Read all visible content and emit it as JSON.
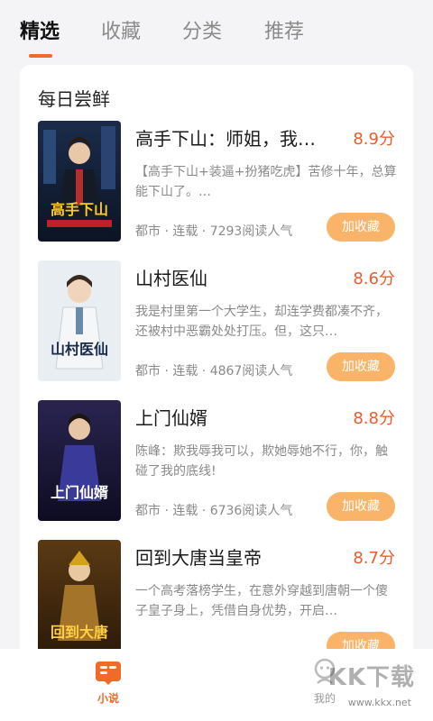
{
  "tabs": [
    {
      "label": "精选",
      "active": true
    },
    {
      "label": "收藏",
      "active": false
    },
    {
      "label": "分类",
      "active": false
    },
    {
      "label": "推荐",
      "active": false
    }
  ],
  "section_title": "每日尝鲜",
  "books": [
    {
      "title": "高手下山：师姐，我…",
      "score": "8.9分",
      "desc": "【高手下山+装逼+扮猪吃虎】苦修十年，总算能下山了。…",
      "meta": "都市 · 连载 · 7293阅读人气",
      "button": "加收藏",
      "cover_text": "高手下山"
    },
    {
      "title": "山村医仙",
      "score": "8.6分",
      "desc": "我是村里第一个大学生，却连学费都凑不齐，还被村中恶霸处处打压。但，这只…",
      "meta": "都市 · 连载 · 4867阅读人气",
      "button": "加收藏",
      "cover_text": "山村医仙"
    },
    {
      "title": "上门仙婿",
      "score": "8.8分",
      "desc": "陈峰：欺我辱我可以，欺她辱她不行，你，触碰了我的底线!",
      "meta": "都市 · 连载 · 6736阅读人气",
      "button": "加收藏",
      "cover_text": "上门仙婿"
    },
    {
      "title": "回到大唐当皇帝",
      "score": "8.7分",
      "desc": "一个高考落榜学生，在意外穿越到唐朝一个傻子皇子身上，凭借自身优势，开启…",
      "meta": "",
      "button": "加收藏",
      "cover_text": "回到大唐"
    }
  ],
  "bottom_nav": [
    {
      "label": "小说",
      "active": true,
      "icon": "book-icon"
    },
    {
      "label": "我的",
      "active": false,
      "icon": "user-icon"
    }
  ],
  "watermark": {
    "text": "KK下载",
    "url": "www.kkx.net"
  },
  "colors": {
    "accent": "#f06a2a",
    "button": "#f9b46a",
    "score": "#f05a2a"
  }
}
